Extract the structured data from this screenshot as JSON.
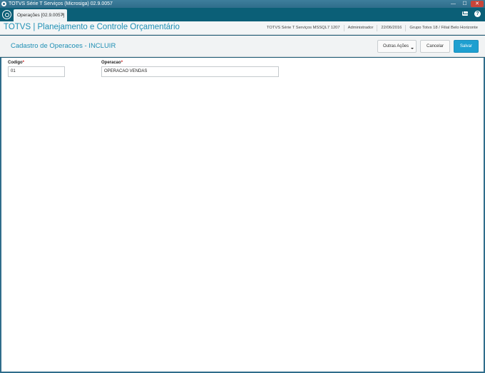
{
  "window": {
    "title": "TOTVS Série T Serviços (Microsiga) 02.9.0057",
    "minimize": "—",
    "maximize": "☐",
    "close": "✕"
  },
  "tabs": [
    {
      "label": "Operações [02.9.0057]",
      "close": "×"
    }
  ],
  "header": {
    "product_title": "TOTVS | Planejamento e Controle Orçamentário",
    "environment": "TOTVS Série T Serviços MSSQL7 1207",
    "user": "Administrador",
    "date": "22/06/2016",
    "company": "Grupo Totvs 18 / Filial Belo Horizonte"
  },
  "form": {
    "title": "Cadastro de Operacoes - INCLUIR",
    "buttons": {
      "other_actions": "Outras Ações",
      "cancel": "Cancelar",
      "save": "Salvar"
    },
    "fields": [
      {
        "label": "Codigo",
        "required_mark": "*",
        "value": "01"
      },
      {
        "label": "Operacao",
        "required_mark": "*",
        "value": "OPERACAO VENDAS"
      }
    ]
  },
  "icons": {
    "home": "home-icon",
    "mail": "mail-icon",
    "help": "help-icon"
  }
}
